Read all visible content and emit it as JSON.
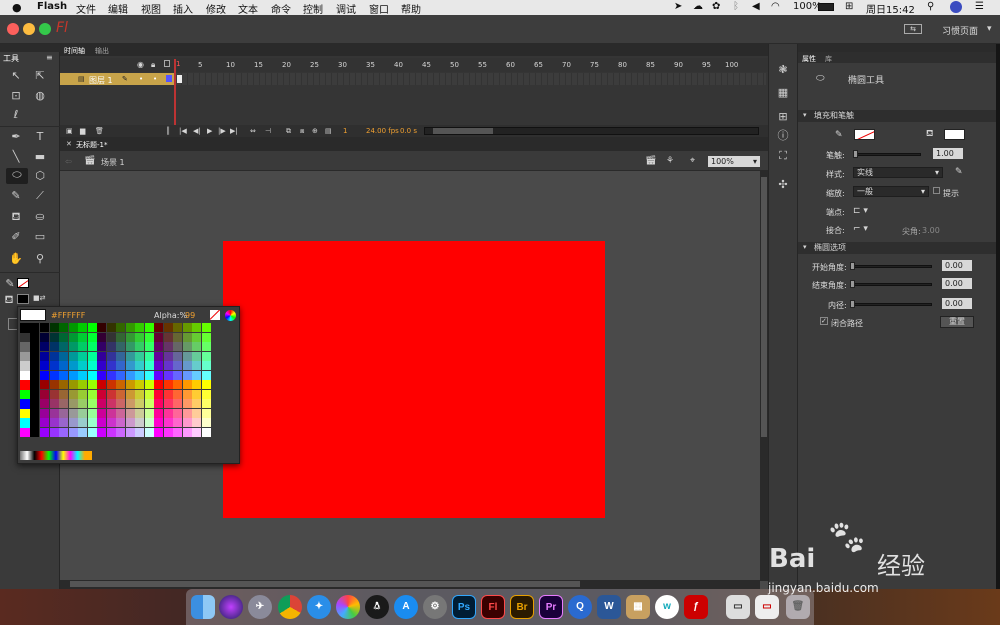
{
  "menubar": {
    "apple": "",
    "app": "Flash",
    "items": [
      "文件",
      "编辑",
      "视图",
      "插入",
      "修改",
      "文本",
      "命令",
      "控制",
      "调试",
      "窗口",
      "帮助"
    ],
    "battery": "100%",
    "clock": "周日15:42"
  },
  "appbar": {
    "logo": "Fl",
    "workspace": "习惯页面"
  },
  "tools": {
    "title": "工具"
  },
  "timeline": {
    "tabs": [
      "时间轴",
      "输出"
    ],
    "ruler": [
      "1",
      "5",
      "10",
      "15",
      "20",
      "25",
      "30",
      "35",
      "40",
      "45",
      "50",
      "55",
      "60",
      "65",
      "70",
      "75",
      "80",
      "85",
      "90",
      "95",
      "100"
    ],
    "layer": "图层 1",
    "frame": "1",
    "fps": "24.00 fps",
    "time": "0.0 s"
  },
  "document": {
    "tab": "无标题-1*",
    "scene": "场景 1",
    "zoom": "100%",
    "stage_color": "#ff0000"
  },
  "swatch": {
    "hex": "#FFFFFF",
    "alpha_label": "Alpha:%",
    "alpha_value": "99"
  },
  "properties": {
    "tabs": [
      "属性",
      "库"
    ],
    "tool_name": "椭圆工具",
    "fill_stroke_title": "填充和笔触",
    "stroke_label": "笔触:",
    "stroke_value": "1.00",
    "style_label": "样式:",
    "style_value": "实线",
    "scale_label": "缩放:",
    "scale_value": "一般",
    "hint_label": "提示",
    "cap_label": "端点:",
    "join_label": "接合:",
    "miter_label": "尖角:",
    "miter_value": "3.00",
    "ellipse_title": "椭圆选项",
    "start_label": "开始角度:",
    "start_value": "0.00",
    "end_label": "结束角度:",
    "end_value": "0.00",
    "inner_label": "内径:",
    "inner_value": "0.00",
    "close_path_label": "闭合路径",
    "reset_label": "重置"
  },
  "dock": {
    "icons": [
      "finder-icon",
      "siri-icon",
      "launchpad-icon",
      "chrome-icon",
      "safari-icon",
      "photos-icon",
      "qq-icon",
      "appstore-icon",
      "settings-icon",
      "photoshop-icon",
      "flash-icon",
      "bridge-icon",
      "premiere-icon",
      "qbrowser-icon",
      "word-icon",
      "archive-icon",
      "wps-icon",
      "flashplayer-icon",
      "preview-icon",
      "prefs-icon",
      "trash-icon"
    ],
    "labels": {
      "ps": "Ps",
      "fl": "Fl",
      "br": "Br",
      "pr": "Pr",
      "w": "W"
    }
  },
  "watermark": {
    "brand": "Bai",
    "brand2": "经验",
    "url": "jingyan.baidu.com"
  }
}
